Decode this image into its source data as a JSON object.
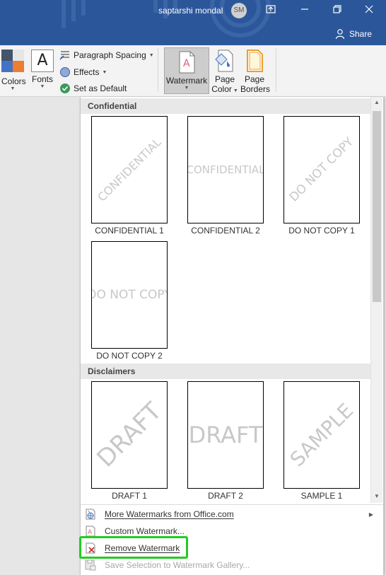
{
  "titlebar": {
    "user_name": "saptarshi mondal",
    "avatar_initials": "SM",
    "share_label": "Share",
    "accent": "#2b579a"
  },
  "ribbon": {
    "colors_label": "Colors",
    "fonts_label": "Fonts",
    "fonts_glyph": "A",
    "paragraph_spacing_label": "Paragraph Spacing",
    "effects_label": "Effects",
    "set_as_default_label": "Set as Default",
    "watermark_label": "Watermark",
    "page_color_line1": "Page",
    "page_color_line2": "Color",
    "page_borders_line1": "Page",
    "page_borders_line2": "Borders"
  },
  "gallery": {
    "sections": [
      {
        "title": "Confidential",
        "items": [
          {
            "caption": "CONFIDENTIAL 1",
            "watermark_text": "CONFIDENTIAL",
            "style": "diagonal"
          },
          {
            "caption": "CONFIDENTIAL 2",
            "watermark_text": "CONFIDENTIAL",
            "style": "horizontal"
          },
          {
            "caption": "DO NOT COPY 1",
            "watermark_text": "DO NOT COPY",
            "style": "diagonal"
          },
          {
            "caption": "DO NOT COPY 2",
            "watermark_text": "DO NOT COPY",
            "style": "horizontal"
          }
        ]
      },
      {
        "title": "Disclaimers",
        "items": [
          {
            "caption": "DRAFT 1",
            "watermark_text": "DRAFT",
            "style": "diagonal"
          },
          {
            "caption": "DRAFT 2",
            "watermark_text": "DRAFT",
            "style": "horizontal"
          },
          {
            "caption": "SAMPLE 1",
            "watermark_text": "SAMPLE",
            "style": "diagonal"
          }
        ]
      }
    ]
  },
  "menu": {
    "more_watermarks": "More Watermarks from Office.com",
    "custom_watermark": "Custom Watermark...",
    "remove_watermark": "Remove Watermark",
    "save_selection": "Save Selection to Watermark Gallery..."
  },
  "highlight_color": "#22cc22"
}
